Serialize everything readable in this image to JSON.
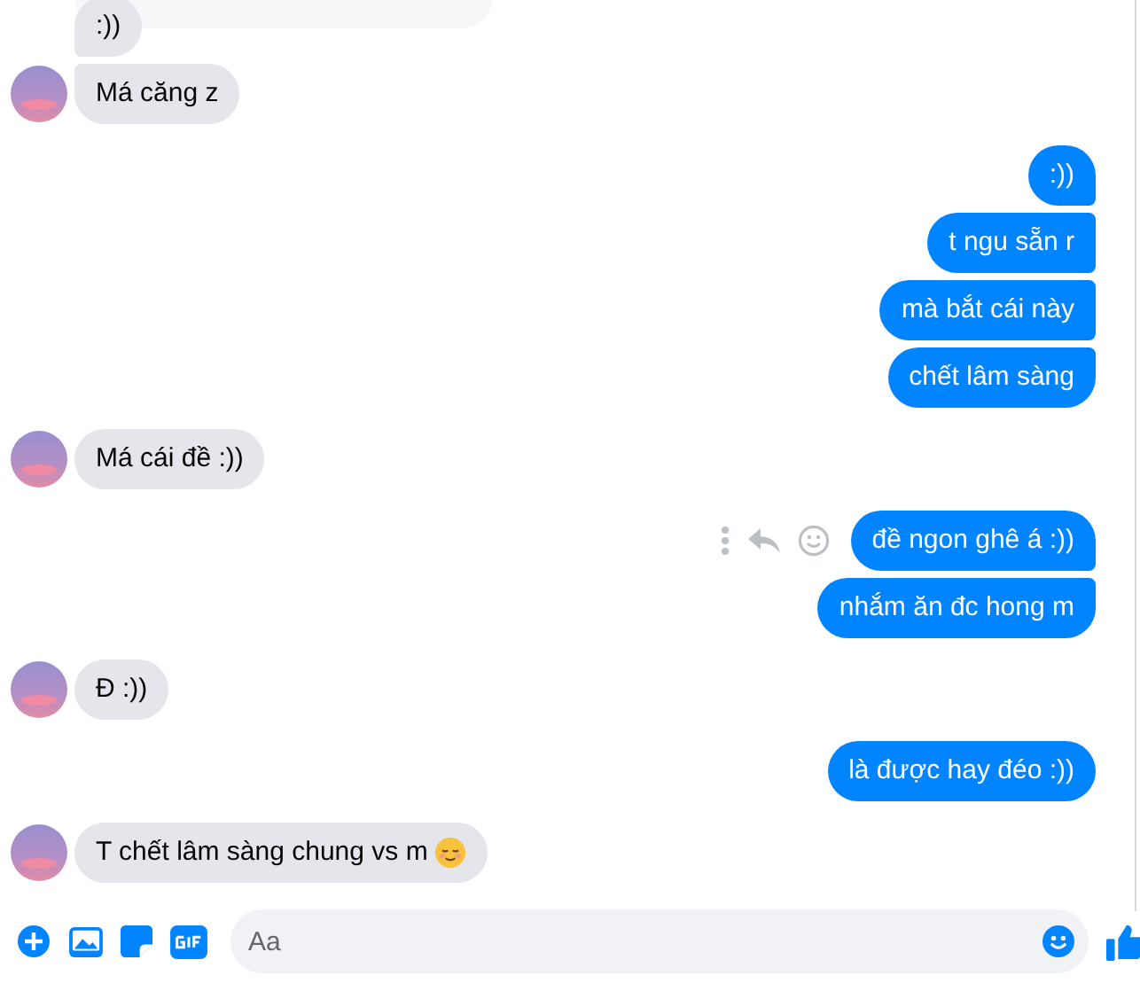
{
  "messages": [
    {
      "kind": "incoming",
      "text": ":))",
      "avatar": false,
      "quoted_card": true
    },
    {
      "kind": "incoming",
      "text": "Má căng z",
      "avatar": true
    },
    {
      "kind": "outgoing",
      "text": ":))"
    },
    {
      "kind": "outgoing",
      "text": "t ngu sẵn r"
    },
    {
      "kind": "outgoing",
      "text": "mà bắt cái này"
    },
    {
      "kind": "outgoing",
      "text": "chết lâm sàng"
    },
    {
      "kind": "incoming",
      "text": "Má cái đề :))",
      "avatar": true
    },
    {
      "kind": "outgoing",
      "text": "đề ngon ghê á :))",
      "actions": true
    },
    {
      "kind": "outgoing",
      "text": "nhắm ăn đc hong m"
    },
    {
      "kind": "incoming",
      "text": "Đ :))",
      "avatar": true
    },
    {
      "kind": "outgoing",
      "text": "là được hay đéo :))"
    },
    {
      "kind": "incoming",
      "text": "T chết lâm sàng chung vs m",
      "avatar": true,
      "trailing_emoji": true
    }
  ],
  "composer": {
    "placeholder": "Aa"
  }
}
